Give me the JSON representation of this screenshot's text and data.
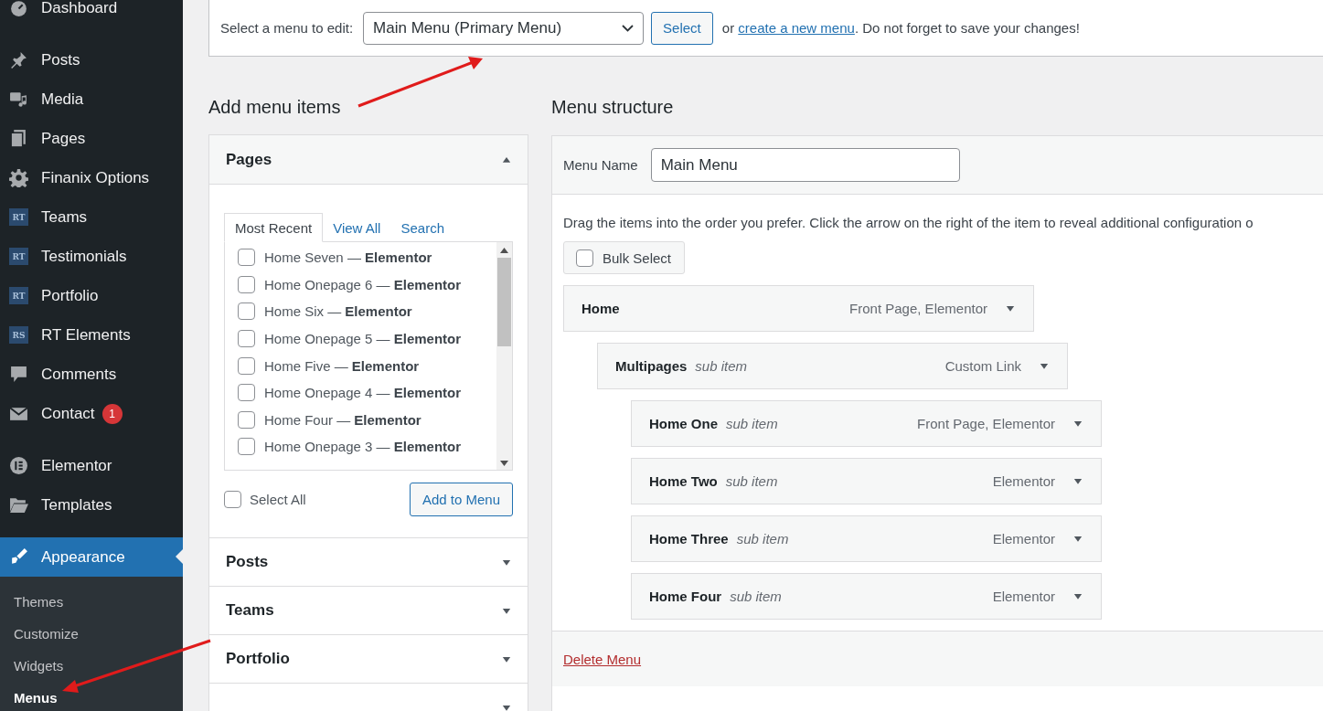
{
  "sidebar": {
    "items": [
      {
        "label": "Dashboard",
        "selected": false
      },
      {
        "label": "Posts",
        "selected": false
      },
      {
        "label": "Media",
        "selected": false
      },
      {
        "label": "Pages",
        "selected": false
      },
      {
        "label": "Finanix Options",
        "selected": false
      },
      {
        "label": "Teams",
        "logo_text": "RT",
        "selected": false
      },
      {
        "label": "Testimonials",
        "logo_text": "RT",
        "selected": false
      },
      {
        "label": "Portfolio",
        "logo_text": "RT",
        "selected": false
      },
      {
        "label": "RT Elements",
        "logo_text": "RS",
        "selected": false
      },
      {
        "label": "Comments",
        "selected": false
      },
      {
        "label": "Contact",
        "badge": "1",
        "selected": false
      },
      {
        "label": "Elementor",
        "selected": false
      },
      {
        "label": "Templates",
        "selected": false
      },
      {
        "label": "Appearance",
        "selected": true,
        "children": [
          {
            "label": "Themes",
            "selected": false
          },
          {
            "label": "Customize",
            "selected": false
          },
          {
            "label": "Widgets",
            "selected": false
          },
          {
            "label": "Menus",
            "selected": true
          }
        ]
      }
    ]
  },
  "menu_picker": {
    "label": "Select a menu to edit:",
    "value": "Main Menu (Primary Menu)",
    "button": "Select",
    "text_before_link": "or",
    "link": "create a new menu",
    "text_after_link": ". Do not forget to save your changes!"
  },
  "add_menu_items": {
    "title": "Add menu items",
    "panels": [
      {
        "title": "Pages",
        "expanded": true,
        "tabs": [
          {
            "label": "Most Recent",
            "selected": true
          },
          {
            "label": "View All",
            "selected": false
          },
          {
            "label": "Search",
            "selected": false
          }
        ],
        "items": [
          {
            "label": "Home Seven — **Elementor**",
            "checked": false
          },
          {
            "label": "Home Onepage 6 — **Elementor**",
            "checked": false
          },
          {
            "label": "Home Six — **Elementor**",
            "checked": false
          },
          {
            "label": "Home Onepage 5 — **Elementor**",
            "checked": false
          },
          {
            "label": "Home Five — **Elementor**",
            "checked": false
          },
          {
            "label": "Home Onepage 4 — **Elementor**",
            "checked": false
          },
          {
            "label": "Home Four — **Elementor**",
            "checked": false
          },
          {
            "label": "Home Onepage 3 — **Elementor**",
            "checked": false
          }
        ],
        "select_all": {
          "label": "Select All",
          "checked": false
        },
        "button": "Add to Menu"
      },
      {
        "title": "Posts",
        "expanded": false
      },
      {
        "title": "Teams",
        "expanded": false
      },
      {
        "title": "Portfolio",
        "expanded": false
      },
      {
        "expanded": false
      }
    ]
  },
  "menu_structure": {
    "title": "Menu structure",
    "menu_name_label": "Menu Name",
    "menu_name": "Main Menu",
    "instructions": "Drag the items into the order you prefer. Click the arrow on the right of the item to reveal additional configuration o",
    "bulk_select": {
      "label": "Bulk Select",
      "checked": false
    },
    "items": [
      {
        "title": "Home",
        "type": "Front Page, Elementor",
        "children": [
          {
            "title": "Multipages",
            "note": "sub item",
            "type": "Custom Link",
            "children": [
              {
                "title": "Home One",
                "note": "sub item",
                "type": "Front Page, Elementor"
              },
              {
                "title": "Home Two",
                "note": "sub item",
                "type": "Elementor"
              },
              {
                "title": "Home Three",
                "note": "sub item",
                "type": "Elementor"
              },
              {
                "title": "Home Four",
                "note": "sub item",
                "type": "Elementor"
              }
            ]
          }
        ]
      }
    ],
    "delete_link": "Delete Menu"
  }
}
